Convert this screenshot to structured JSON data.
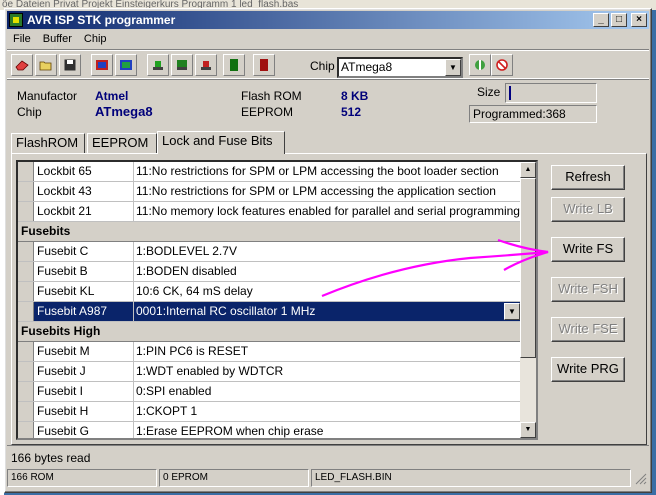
{
  "background": {
    "text": "öe Dateien Privat Projekt Einsteigerkurs Programm 1 led_flash.bas"
  },
  "window": {
    "title": "AVR ISP STK programmer",
    "controls": [
      "_",
      "□",
      "×"
    ]
  },
  "menu": [
    "File",
    "Buffer",
    "Chip"
  ],
  "toolbar": {
    "icons": [
      "erase-icon",
      "open-folder-icon",
      "save-icon",
      "read-chip-icon",
      "write-chip-icon",
      "chip-green-icon",
      "chip-grid-icon",
      "chip-red-icon",
      "green-module-icon",
      "red-module-icon",
      "connect-icon",
      "stop-icon"
    ],
    "chip_label": "Chip",
    "chip_value": "ATmega8"
  },
  "info": {
    "manufactor_label": "Manufactor",
    "manufactor_value": "Atmel",
    "chip_label": "Chip",
    "chip_value": "ATmega8",
    "flash_label": "Flash ROM",
    "flash_value": "8 KB",
    "eeprom_label": "EEPROM",
    "eeprom_value": "512",
    "size_label": "Size",
    "programmed": "Programmed:368"
  },
  "tabs": [
    "FlashROM",
    "EEPROM",
    "Lock and Fuse Bits"
  ],
  "grid": {
    "rows": [
      {
        "type": "item",
        "name": "Lockbit 65",
        "value": "11:No restrictions for SPM or LPM accessing the boot loader section"
      },
      {
        "type": "item",
        "name": "Lockbit 43",
        "value": "11:No restrictions for SPM or LPM accessing the application section"
      },
      {
        "type": "item",
        "name": "Lockbit 21",
        "value": "11:No memory lock features enabled for parallel and serial programming"
      },
      {
        "type": "section",
        "name": "Fusebits"
      },
      {
        "type": "item",
        "name": "Fusebit C",
        "value": "1:BODLEVEL 2.7V"
      },
      {
        "type": "item",
        "name": "Fusebit B",
        "value": "1:BODEN disabled"
      },
      {
        "type": "item",
        "name": "Fusebit KL",
        "value": "10:6 CK, 64 mS delay"
      },
      {
        "type": "selected",
        "name": "Fusebit A987",
        "value": "0001:Internal RC oscillator 1 MHz"
      },
      {
        "type": "section",
        "name": "Fusebits High"
      },
      {
        "type": "item",
        "name": "Fusebit M",
        "value": "1:PIN PC6 is RESET"
      },
      {
        "type": "item",
        "name": "Fusebit J",
        "value": "1:WDT enabled by WDTCR"
      },
      {
        "type": "item",
        "name": "Fusebit I",
        "value": "0:SPI enabled"
      },
      {
        "type": "item",
        "name": "Fusebit H",
        "value": "1:CKOPT 1"
      },
      {
        "type": "item",
        "name": "Fusebit G",
        "value": "1:Erase EEPROM when chip erase"
      }
    ]
  },
  "buttons": [
    {
      "label": "Refresh",
      "enabled": true
    },
    {
      "label": "Write LB",
      "enabled": false
    },
    {
      "label": "Write FS",
      "enabled": true
    },
    {
      "label": "Write FSH",
      "enabled": false
    },
    {
      "label": "Write FSE",
      "enabled": false
    },
    {
      "label": "Write PRG",
      "enabled": true
    }
  ],
  "status_message": "166 bytes read",
  "statusbar": [
    "166 ROM",
    "0 EPROM",
    "LED_FLASH.BIN"
  ],
  "colors": {
    "selection": "#0a246a",
    "annotation": "#ff00ff",
    "value_text": "#00007a"
  }
}
